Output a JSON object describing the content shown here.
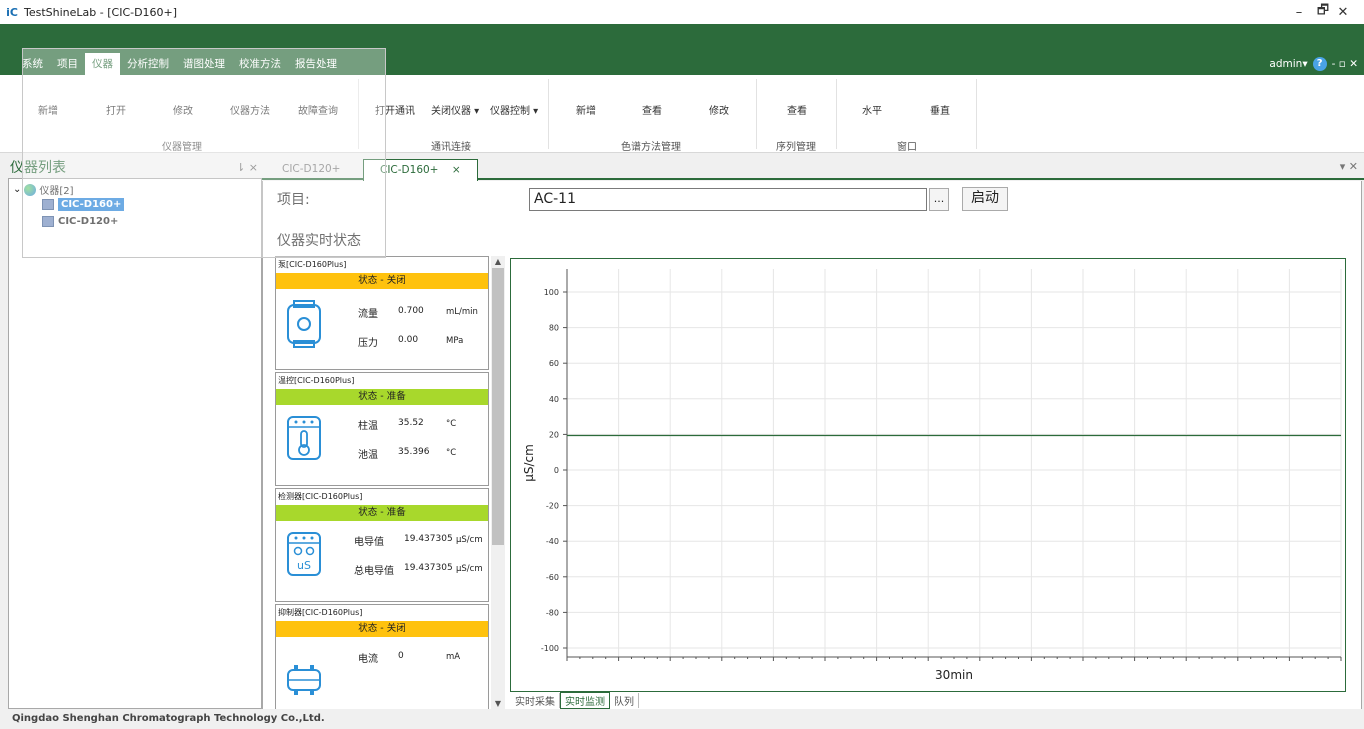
{
  "window": {
    "logo": "iC",
    "title": "TestShineLab - [CIC-D160+]",
    "controls": {
      "minimize": "–",
      "restore": "🗗",
      "close": "✕"
    }
  },
  "menu": {
    "tabs": [
      "系统",
      "项目",
      "仪器",
      "分析控制",
      "谱图处理",
      "校准方法",
      "报告处理"
    ],
    "active_index": 2,
    "user": "admin",
    "user_arrow": "▾",
    "help": "?",
    "mdi_controls": "- ▫ ✕"
  },
  "ribbon": {
    "groups": [
      {
        "label": "仪器管理",
        "buttons": [
          "新增",
          "打开",
          "修改",
          "仪器方法",
          "故障查询"
        ]
      },
      {
        "label": "通讯连接",
        "buttons": [
          "打开通讯",
          "关闭仪器 ▾",
          "仪器控制 ▾"
        ]
      },
      {
        "label": "色谱方法管理",
        "buttons": [
          "新增",
          "查看",
          "修改"
        ]
      },
      {
        "label": "序列管理",
        "buttons": [
          "查看"
        ]
      },
      {
        "label": "窗口",
        "buttons": [
          "水平",
          "垂直"
        ]
      }
    ]
  },
  "left_panel": {
    "title": "仪器列表",
    "controls": "⇂ ×",
    "root_label": "仪器[2]",
    "items": [
      {
        "label": "CIC-D160+",
        "selected": true
      },
      {
        "label": "CIC-D120+",
        "selected": false
      }
    ]
  },
  "doc_tabs": {
    "tabs": [
      {
        "label": "CIC-D120+",
        "active": false
      },
      {
        "label": "CIC-D160+",
        "active": true,
        "close": "×"
      }
    ],
    "panel_controls": "▾ ✕"
  },
  "main": {
    "project_label": "项目:",
    "project_value": "AC-11",
    "browse_label": "...",
    "start_label": "启动",
    "section_title": "仪器实时状态"
  },
  "cards": [
    {
      "title": "泵[CIC-D160Plus]",
      "status": "状态 - 关闭",
      "status_color": "#ffc20e",
      "icon": "pump-icon",
      "rows": [
        {
          "label": "流量",
          "value": "0.700",
          "unit": "mL/min"
        },
        {
          "label": "压力",
          "value": "0.00",
          "unit": "MPa"
        }
      ]
    },
    {
      "title": "温控[CIC-D160Plus]",
      "status": "状态 - 准备",
      "status_color": "#a8d82c",
      "icon": "thermometer-icon",
      "rows": [
        {
          "label": "柱温",
          "value": "35.52",
          "unit": "°C"
        },
        {
          "label": "池温",
          "value": "35.396",
          "unit": "°C"
        }
      ]
    },
    {
      "title": "检测器[CIC-D160Plus]",
      "status": "状态 - 准备",
      "status_color": "#a8d82c",
      "icon": "detector-icon",
      "icon_text": "uS",
      "rows": [
        {
          "label": "电导值",
          "value": "19.437305",
          "unit": "μS/cm"
        },
        {
          "label": "总电导值",
          "value": "19.437305",
          "unit": "μS/cm"
        }
      ]
    },
    {
      "title": "抑制器[CIC-D160Plus]",
      "status": "状态 - 关闭",
      "status_color": "#ffc20e",
      "icon": "suppressor-icon",
      "rows": [
        {
          "label": "电流",
          "value": "0",
          "unit": "mA"
        }
      ]
    }
  ],
  "chart_data": {
    "type": "line",
    "ylabel": "μS/cm",
    "xlabel": "30min",
    "ylim": [
      -100,
      100
    ],
    "yticks": [
      100,
      80,
      60,
      40,
      20,
      0,
      -20,
      -40,
      -60,
      -80,
      -100
    ],
    "grid": true,
    "series": [
      {
        "x": [
          0,
          30
        ],
        "values": [
          19.4,
          19.4
        ],
        "color": "#2c6b3b"
      }
    ]
  },
  "bottom_tabs": {
    "tabs": [
      "实时采集",
      "实时监测",
      "队列"
    ],
    "active_index": 1
  },
  "status_bar": {
    "company": "Qingdao Shenghan Chromatograph Technology Co.,Ltd."
  }
}
